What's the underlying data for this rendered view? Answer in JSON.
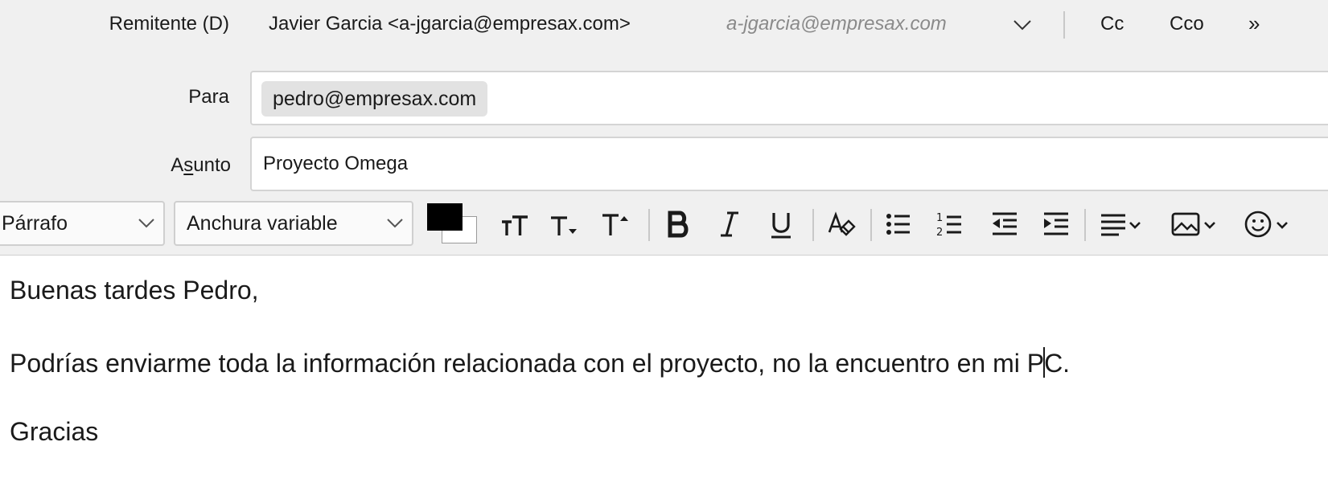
{
  "compose": {
    "from_label": "Remitente (D)",
    "from_sender": "Javier Garcia <a-jgarcia@empresax.com>",
    "from_identity": "a-jgarcia@empresax.com",
    "cc_label": "Cc",
    "bcc_label": "Cco",
    "more_label": "»",
    "to_label": "Para",
    "recipients": [
      "pedro@empresax.com"
    ],
    "subject_label_pre": "A",
    "subject_label_key": "s",
    "subject_label_post": "unto",
    "subject": "Proyecto Omega"
  },
  "toolbar": {
    "paragraph_format": "Párrafo",
    "font_width": "Anchura variable",
    "text_color": "#000000",
    "background_color": "#ffffff",
    "buttons": [
      {
        "icon": "smaller-size-icon",
        "glyph": "tT"
      },
      {
        "icon": "text-smaller-icon",
        "glyph": "T▾"
      },
      {
        "icon": "text-larger-icon",
        "glyph": "T▴"
      },
      {
        "icon": "bold-icon",
        "glyph": "B"
      },
      {
        "icon": "italic-icon",
        "glyph": "I"
      },
      {
        "icon": "underline-icon",
        "glyph": "U"
      },
      {
        "icon": "remove-formatting-icon"
      },
      {
        "icon": "bulleted-list-icon"
      },
      {
        "icon": "numbered-list-icon"
      },
      {
        "icon": "outdent-icon"
      },
      {
        "icon": "indent-icon"
      },
      {
        "icon": "align-icon"
      },
      {
        "icon": "insert-image-icon"
      },
      {
        "icon": "insert-emoji-icon"
      }
    ]
  },
  "body": {
    "greeting": "Buenas tardes Pedro,",
    "line2_before_caret": "Podrías enviarme toda la información relacionada con el proyecto, no la encuentro en mi P",
    "line2_after_caret": "C.",
    "closing": "Gracias"
  }
}
